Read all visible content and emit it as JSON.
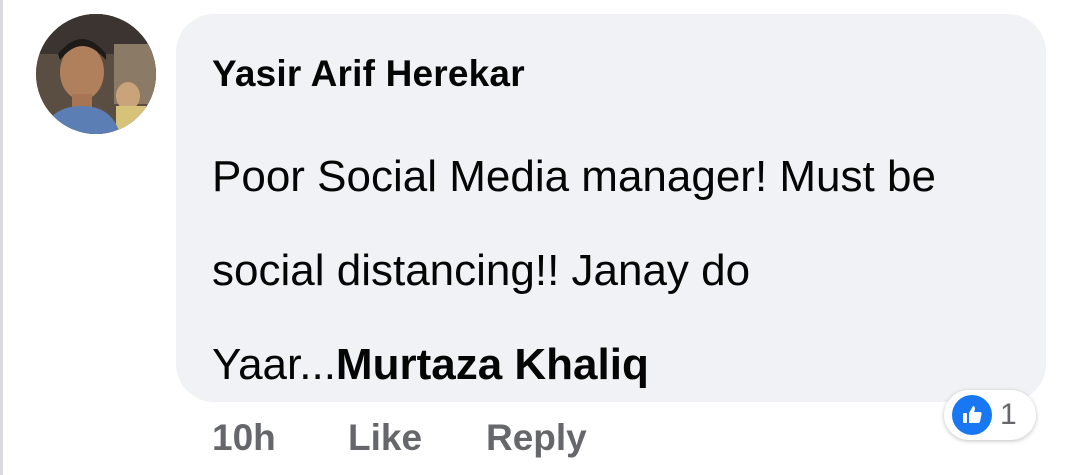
{
  "comment": {
    "author": "Yasir Arif Herekar",
    "text": "Poor Social Media manager! Must be social distancing!! Janay do Yaar...",
    "mention": "Murtaza Khaliq",
    "avatar_icon": "profile-photo"
  },
  "actions": {
    "time": "10h",
    "like_label": "Like",
    "reply_label": "Reply"
  },
  "reactions": {
    "icon": "thumbs-up-icon",
    "count": "1",
    "accent": "#1877f2"
  },
  "colors": {
    "bubble": "#f0f2f5",
    "text": "#050505",
    "muted": "#65676b"
  }
}
